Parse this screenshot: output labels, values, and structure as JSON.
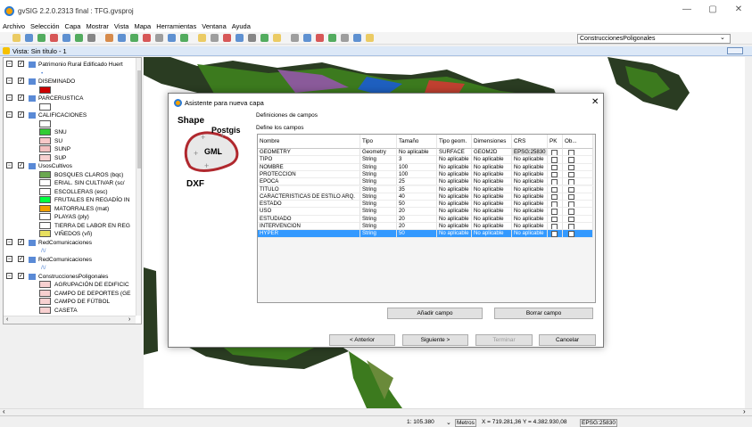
{
  "window": {
    "title": "gvSIG 2.2.0.2313 final : TFG.gvsproj",
    "controls": [
      "—",
      "▢",
      "✕"
    ]
  },
  "menu": [
    "Archivo",
    "Selección",
    "Capa",
    "Mostrar",
    "Vista",
    "Mapa",
    "Herramientas",
    "Ventana",
    "Ayuda"
  ],
  "layer_selector": "ConstruccionesPoligonales",
  "view_title": "Vista: Sin título - 1",
  "toc": {
    "rows": [
      {
        "label": "Patrimonio Rural Edificado Huert",
        "type": "layer"
      },
      {
        "label": "•",
        "type": "legend"
      },
      {
        "label": "DISEMINADO",
        "type": "layer"
      },
      {
        "label": "",
        "type": "legend-swatch",
        "color": "#cc0000"
      },
      {
        "label": "PARCERUSTICA",
        "type": "layer"
      },
      {
        "label": "",
        "type": "legend-swatch",
        "color": "#ffffff"
      },
      {
        "label": "CALIFICACIONES",
        "type": "layer"
      },
      {
        "label": "",
        "type": "legend-swatch",
        "color": "#ffffff"
      },
      {
        "label": "SNU",
        "type": "class",
        "color": "#33cc33"
      },
      {
        "label": "SU",
        "type": "class",
        "color": "#f8c8c8"
      },
      {
        "label": "SUNP",
        "type": "class",
        "color": "#f4c0c0"
      },
      {
        "label": "SUP",
        "type": "class",
        "color": "#f8d0d0"
      },
      {
        "label": "UsosCultivos",
        "type": "layer"
      },
      {
        "label": "BOSQUES CLAROS (bqc)",
        "type": "class",
        "color": "#6aa84f"
      },
      {
        "label": "ERIAL. SIN CULTIVAR (sc/",
        "type": "class",
        "color": "#ffffff"
      },
      {
        "label": "ESCOLLERAS (esc)",
        "type": "class",
        "color": "#ffffff"
      },
      {
        "label": "FRUTALES EN REGADÍO IN",
        "type": "class",
        "color": "#00ff40"
      },
      {
        "label": "MATORRALES (mat)",
        "type": "class",
        "color": "#f0a000"
      },
      {
        "label": "PLAYAS (ply)",
        "type": "class",
        "color": "#ffffff"
      },
      {
        "label": "TIERRA DE LABOR EN REG",
        "type": "class",
        "color": "#ffffff"
      },
      {
        "label": "VIÑEDOS (vñ)",
        "type": "class",
        "color": "#e8e060"
      },
      {
        "label": "RedComunicaciones",
        "type": "layer"
      },
      {
        "label": "/\\/",
        "type": "legend"
      },
      {
        "label": "RedComunicaciones",
        "type": "layer"
      },
      {
        "label": "/\\/",
        "type": "legend"
      },
      {
        "label": "ConstruccionesPoligonales",
        "type": "layer"
      },
      {
        "label": "AGRUPACIÓN DE EDIFICIC",
        "type": "class",
        "color": "#f8d0d0"
      },
      {
        "label": "CAMPO DE DEPORTES (GE",
        "type": "class",
        "color": "#f8d0d0"
      },
      {
        "label": "CAMPO DE FÚTBOL",
        "type": "class",
        "color": "#f8d0d0"
      },
      {
        "label": "CASETA",
        "type": "class",
        "color": "#f8d0d0"
      }
    ]
  },
  "dialog": {
    "title": "Asistente para nueva capa",
    "close": "✕",
    "decor": {
      "shape": "Shape",
      "postgis": "Postgis",
      "gml": "GML",
      "dxf": "DXF"
    },
    "section": "Definiciones de campos",
    "subsection": "Define los campos",
    "columns": [
      "Nombre",
      "Tipo",
      "Tamaño",
      "Tipo geom.",
      "Dimensiones",
      "CRS",
      "PK",
      "Ob..."
    ],
    "rows": [
      {
        "nombre": "GEOMETRY",
        "tipo": "Geometry",
        "tamano": "No aplicable",
        "tipogeom": "SURFACE",
        "dim": "GEOM2D",
        "crs": "EPSG:25830",
        "selected": false
      },
      {
        "nombre": "TIPO",
        "tipo": "String",
        "tamano": "3",
        "tipogeom": "No aplicable",
        "dim": "No aplicable",
        "crs": "No aplicable",
        "selected": false
      },
      {
        "nombre": "NOMBRE",
        "tipo": "String",
        "tamano": "100",
        "tipogeom": "No aplicable",
        "dim": "No aplicable",
        "crs": "No aplicable",
        "selected": false
      },
      {
        "nombre": "PROTECCIÓN",
        "tipo": "String",
        "tamano": "100",
        "tipogeom": "No aplicable",
        "dim": "No aplicable",
        "crs": "No aplicable",
        "selected": false
      },
      {
        "nombre": "EPOCA",
        "tipo": "String",
        "tamano": "25",
        "tipogeom": "No aplicable",
        "dim": "No aplicable",
        "crs": "No aplicable",
        "selected": false
      },
      {
        "nombre": "TÍTULO",
        "tipo": "String",
        "tamano": "35",
        "tipogeom": "No aplicable",
        "dim": "No aplicable",
        "crs": "No aplicable",
        "selected": false
      },
      {
        "nombre": "CARACTERÍSTICAS DE ESTILO ARQ.",
        "tipo": "String",
        "tamano": "40",
        "tipogeom": "No aplicable",
        "dim": "No aplicable",
        "crs": "No aplicable",
        "selected": false
      },
      {
        "nombre": "ESTADO",
        "tipo": "String",
        "tamano": "50",
        "tipogeom": "No aplicable",
        "dim": "No aplicable",
        "crs": "No aplicable",
        "selected": false
      },
      {
        "nombre": "USO",
        "tipo": "String",
        "tamano": "20",
        "tipogeom": "No aplicable",
        "dim": "No aplicable",
        "crs": "No aplicable",
        "selected": false
      },
      {
        "nombre": "ESTUDIADO",
        "tipo": "String",
        "tamano": "20",
        "tipogeom": "No aplicable",
        "dim": "No aplicable",
        "crs": "No aplicable",
        "selected": false
      },
      {
        "nombre": "INTERVENCIÓN",
        "tipo": "String",
        "tamano": "20",
        "tipogeom": "No aplicable",
        "dim": "No aplicable",
        "crs": "No aplicable",
        "selected": false
      },
      {
        "nombre": "HYPER",
        "tipo": "String",
        "tamano": "50",
        "tipogeom": "No aplicable",
        "dim": "No aplicable",
        "crs": "No aplicable",
        "selected": true
      }
    ],
    "add_field": "Añadir campo",
    "remove_field": "Borrar campo",
    "prev": "< Anterior",
    "next": "Siguiente >",
    "finish": "Terminar",
    "cancel": "Cancelar"
  },
  "status": {
    "scale": "1: 105.380",
    "units": "Metros",
    "coords": "X = 719.281,36 Y = 4.382.930,08",
    "crs": "EPSG:25830"
  },
  "colors": {
    "selection": "#3399ff",
    "map_green": "#3c7a1e",
    "map_dark": "#1a2418",
    "map_blue": "#1e5fbf"
  }
}
